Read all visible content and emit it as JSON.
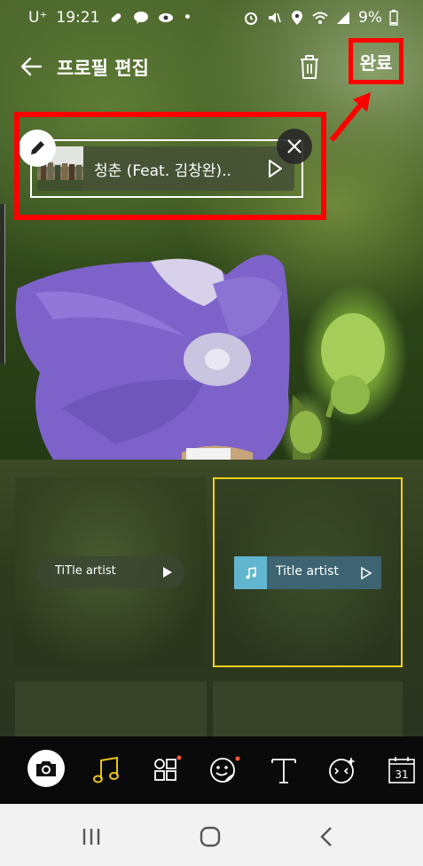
{
  "status_bar": {
    "carrier": "U⁺",
    "time": "19:21",
    "battery": "9%"
  },
  "header": {
    "title": "프로필 편집",
    "done_label": "완료"
  },
  "music_sticker": {
    "song_title": "청춘 (Feat. 김창완).."
  },
  "styles": [
    {
      "label": "TiTle  artist",
      "style": "pill"
    },
    {
      "label": "Title  artist",
      "style": "rect",
      "selected": true
    }
  ],
  "toolbar": {
    "items": [
      "camera-icon",
      "music-icon",
      "apps-icon",
      "sticker-icon",
      "text-icon",
      "effect-icon",
      "calendar-icon"
    ],
    "calendar_day": "31"
  },
  "colors": {
    "highlight": "#ff0000",
    "selection": "#f2d21b",
    "accent_music": "#e8c21a",
    "chip_icon": "#62b5cf",
    "notification_dot": "#ff5a3c"
  }
}
